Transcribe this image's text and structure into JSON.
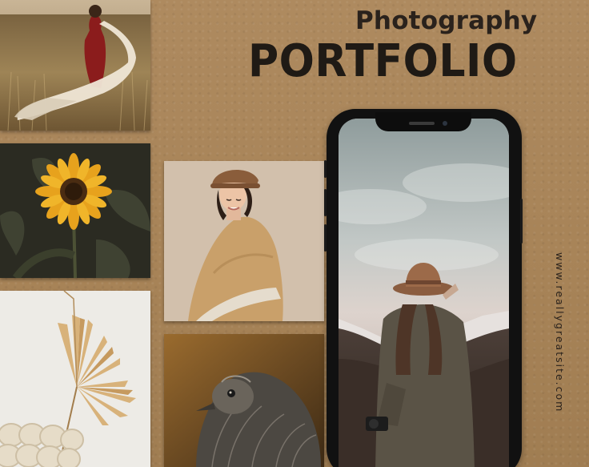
{
  "title": {
    "subtitle": "Photography",
    "main": "PORTFOLIO"
  },
  "website": "www.reallygreatsite.com",
  "photos": [
    {
      "id": "field",
      "subject": "woman in red dress with white shawl in wheat field"
    },
    {
      "id": "sunflower",
      "subject": "sunflower on dark background"
    },
    {
      "id": "portrait",
      "subject": "smiling woman in brown cap and beige wrap"
    },
    {
      "id": "palm",
      "subject": "dried palm leaf and chunky knit"
    },
    {
      "id": "emu",
      "subject": "emu head close-up"
    }
  ],
  "phone": {
    "screen_subject": "woman in brown hat and coat in mountains holding camera"
  },
  "colors": {
    "background": "#a9865c",
    "text_dark": "#1f1a15",
    "phone_body": "#111111"
  }
}
